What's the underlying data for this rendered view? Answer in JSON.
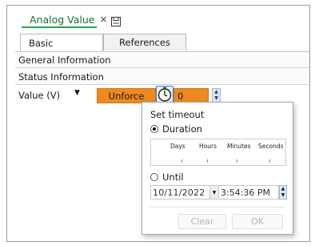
{
  "document_tab": {
    "title": "Analog Value",
    "close_glyph": "×",
    "save_icon": "save-icon"
  },
  "subtabs": [
    {
      "label": "Basic"
    },
    {
      "label": "References"
    }
  ],
  "sections": {
    "general": "General Information",
    "status": "Status Information"
  },
  "value_row": {
    "label": "Value (V)",
    "dropdown_glyph": "▼",
    "unforce_label": "Unforce",
    "value": "0",
    "timer_icon": "clock-icon"
  },
  "timeout_popup": {
    "title": "Set timeout",
    "duration_label": "Duration",
    "duration_selected": true,
    "duration_columns": [
      "Days",
      "Hours",
      "Minutes",
      "Seconds"
    ],
    "until_label": "Until",
    "date": {
      "month": "10",
      "day": "11",
      "year": "2022",
      "sep": "/"
    },
    "time": "3:54:36 PM",
    "clear_label": "Clear",
    "ok_label": "OK"
  },
  "colors": {
    "accent_green": "#2ea24b",
    "forced_orange": "#ed8a1f",
    "focus_blue": "#3b7bd5"
  }
}
